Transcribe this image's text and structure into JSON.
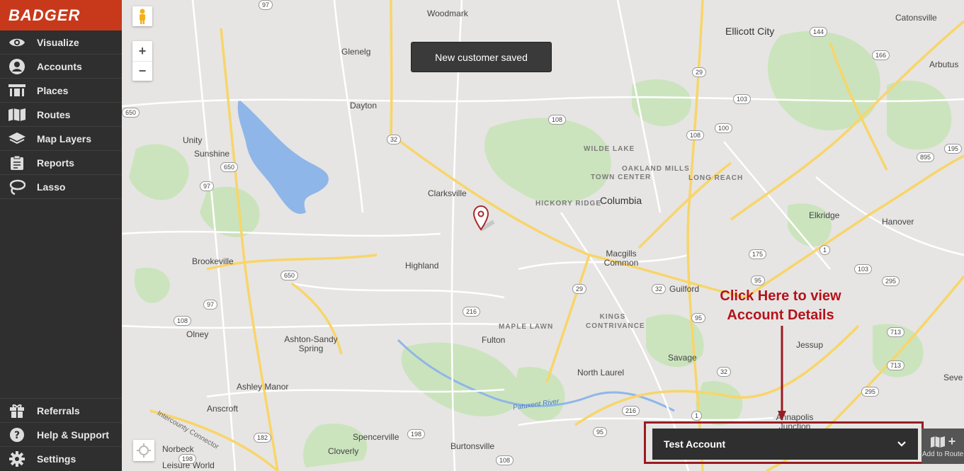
{
  "brand": {
    "name": "BADGER",
    "color": "#c8391c"
  },
  "sidebar": {
    "items": [
      {
        "label": "Visualize",
        "icon": "eye-icon"
      },
      {
        "label": "Accounts",
        "icon": "user-icon"
      },
      {
        "label": "Places",
        "icon": "building-icon"
      },
      {
        "label": "Routes",
        "icon": "map-icon"
      },
      {
        "label": "Map Layers",
        "icon": "layers-icon"
      },
      {
        "label": "Reports",
        "icon": "clipboard-icon"
      },
      {
        "label": "Lasso",
        "icon": "lasso-icon"
      }
    ],
    "bottom_items": [
      {
        "label": "Referrals",
        "icon": "gift-icon"
      },
      {
        "label": "Help & Support",
        "icon": "question-icon"
      },
      {
        "label": "Settings",
        "icon": "gear-icon"
      }
    ]
  },
  "map": {
    "toast": "New customer saved",
    "zoom_in": "+",
    "zoom_out": "−",
    "places": [
      "Woodmark",
      "Ellicott City",
      "Catonsville",
      "Glenelg",
      "Arbutus",
      "Dayton",
      "Unity",
      "Sunshine",
      "Clarksville",
      "Columbia",
      "Elkridge",
      "Hanover",
      "Macgills Common",
      "Highland",
      "Guilford",
      "Brookeville",
      "Jessup",
      "Olney",
      "Fulton",
      "Savage",
      "Ashton-Sandy Spring",
      "North Laurel",
      "Ashley Manor",
      "Anscroft",
      "Annapolis Junction",
      "Spencerville",
      "Norbeck",
      "Cloverly",
      "Burtonsville",
      "Leisure World",
      "Seve"
    ],
    "neighborhoods": [
      "WILDE LAKE",
      "OAKLAND MILLS",
      "TOWN CENTER",
      "LONG REACH",
      "HICKORY RIDGE",
      "KINGS CONTRIVANCE",
      "MAPLE LAWN"
    ],
    "rivers": [
      "Patuxent River"
    ],
    "roads": [
      "Intercounty Connector"
    ],
    "shields": [
      "97",
      "144",
      "166",
      "29",
      "103",
      "650",
      "108",
      "100",
      "32",
      "195",
      "895",
      "108",
      "650",
      "97",
      "175",
      "1",
      "95",
      "103",
      "295",
      "650",
      "29",
      "32",
      "216",
      "108",
      "97",
      "95",
      "713",
      "713",
      "295",
      "32",
      "1",
      "216",
      "95",
      "182",
      "198",
      "108",
      "198",
      "29"
    ]
  },
  "annotation": {
    "line1": "Click Here to view",
    "line2": "Account Details",
    "color": "#b5121b"
  },
  "account": {
    "name": "Test Account",
    "chevron": "⌄"
  },
  "add_route": {
    "label": "Add to Route",
    "plus": "+"
  }
}
